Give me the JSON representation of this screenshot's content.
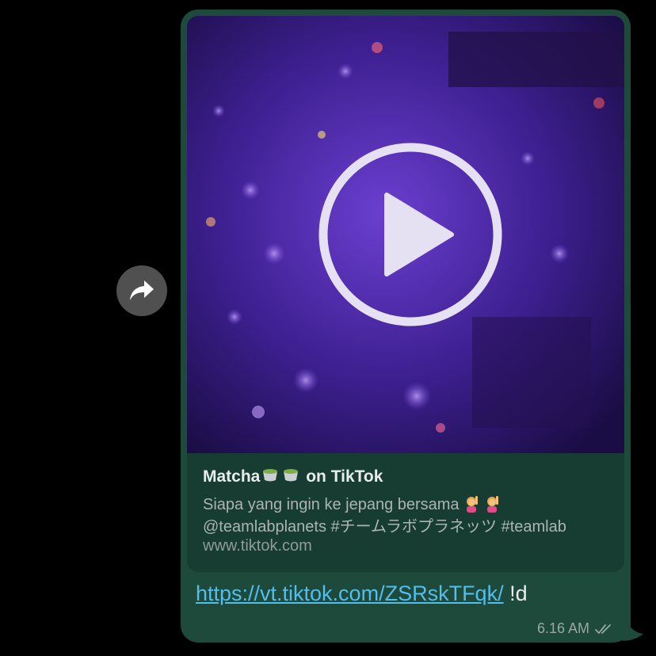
{
  "actions": {
    "forward_icon": "forward-arrow-icon"
  },
  "colors": {
    "bubble": "#1d4a3b",
    "preview_card": "#173c31",
    "link": "#53bdeb",
    "forward_button": "#505050"
  },
  "preview": {
    "thumbnail_icon": "video-play-icon",
    "title_text": "Matcha",
    "title_suffix": "on TikTok",
    "desc_line1": "Siapa yang ingin ke jepang bersama",
    "desc_line2": "@teamlabplanets  #チームラボプラネッツ #teamlab",
    "domain": "www.tiktok.com"
  },
  "message": {
    "link": "https://vt.tiktok.com/ZSRskTFqk/",
    "suffix": "!d",
    "time": "6.16 AM",
    "status_icon": "double-check-icon"
  }
}
